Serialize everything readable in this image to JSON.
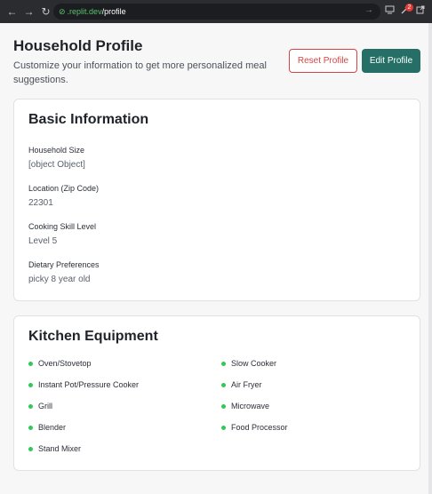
{
  "browser": {
    "back": "←",
    "forward": "→",
    "reload": "↻",
    "url_lock": "⊘",
    "url_host": ".replit.dev",
    "url_path": "/profile",
    "url_go": "→",
    "badge_count": "2"
  },
  "header": {
    "title": "Household Profile",
    "subtitle": "Customize your information to get more personalized meal suggestions."
  },
  "actions": {
    "reset_label": "Reset Profile",
    "edit_label": "Edit Profile"
  },
  "basic_info": {
    "title": "Basic Information",
    "fields": [
      {
        "label": "Household Size",
        "value": "[object Object]"
      },
      {
        "label": "Location (Zip Code)",
        "value": "22301"
      },
      {
        "label": "Cooking Skill Level",
        "value": "Level 5"
      },
      {
        "label": "Dietary Preferences",
        "value": "picky 8 year old"
      }
    ]
  },
  "kitchen": {
    "title": "Kitchen Equipment",
    "items": [
      "Oven/Stovetop",
      "Slow Cooker",
      "Instant Pot/Pressure Cooker",
      "Air Fryer",
      "Grill",
      "Microwave",
      "Blender",
      "Food Processor",
      "Stand Mixer"
    ]
  },
  "colors": {
    "accent": "#256f66",
    "danger": "#d64545",
    "bullet": "#2ec95a"
  }
}
